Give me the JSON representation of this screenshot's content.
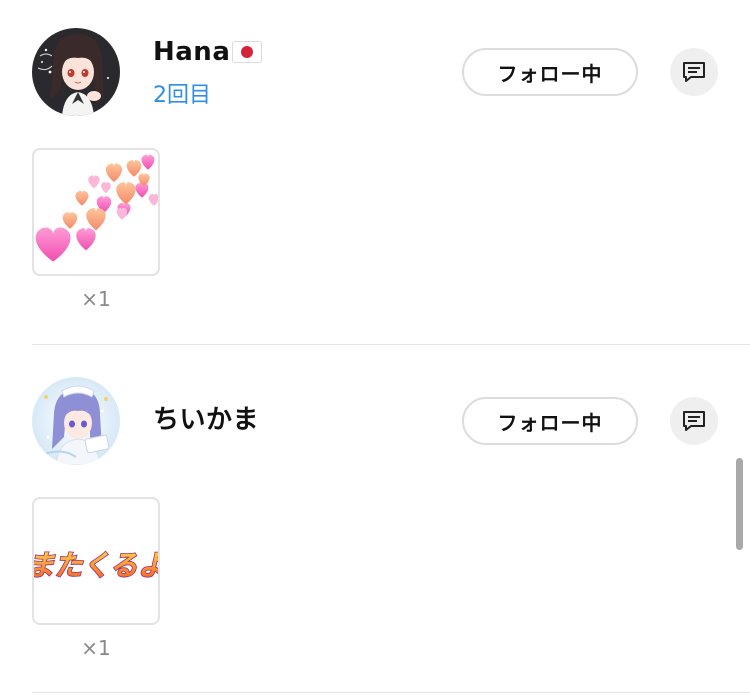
{
  "entries": [
    {
      "username": "Hana",
      "visits": "2回目",
      "follow_label": "フォロー中",
      "gift_count": "×1",
      "gift_icon": "hearts-sticker"
    },
    {
      "username": "ちいかま",
      "follow_label": "フォロー中",
      "gift_count": "×1",
      "gift_icon": "matakuruyo-sticker",
      "gift_text": "またくるよ"
    }
  ],
  "colors": {
    "accent": "#2f8fe6",
    "muted": "#888888",
    "divider": "#e6e6e6"
  }
}
